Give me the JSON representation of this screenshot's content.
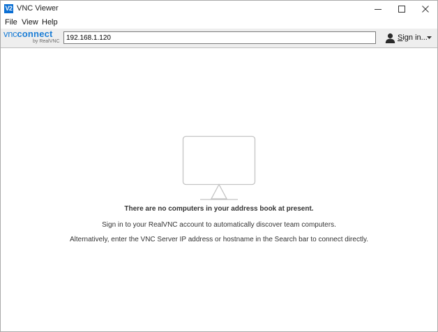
{
  "window": {
    "app_icon_text": "V2",
    "title": "VNC Viewer"
  },
  "menu": {
    "file": "File",
    "view": "View",
    "help": "Help"
  },
  "toolbar": {
    "brand_vnc": "vnc",
    "brand_connect": "connect",
    "brand_sub": "by RealVNC",
    "search_value": "192.168.1.120",
    "signin_label_first": "S",
    "signin_label_rest": "ign in..."
  },
  "content": {
    "empty_title": "There are no computers in your address book at present.",
    "line1": "Sign in to your RealVNC account to automatically discover team computers.",
    "line2": "Alternatively, enter the VNC Server IP address or hostname in the Search bar to connect directly."
  },
  "colors": {
    "brand_blue": "#1c7ed6",
    "app_icon_blue": "#0b6fd3",
    "toolbar_bg": "#eeeeee",
    "monitor_stroke": "#c4c4c4"
  },
  "icons": {
    "app": "vnc-app-icon",
    "minimize": "minimize-icon",
    "maximize": "maximize-icon",
    "close": "close-icon",
    "user": "user-icon",
    "caret": "chevron-down-icon",
    "monitor": "monitor-icon"
  }
}
